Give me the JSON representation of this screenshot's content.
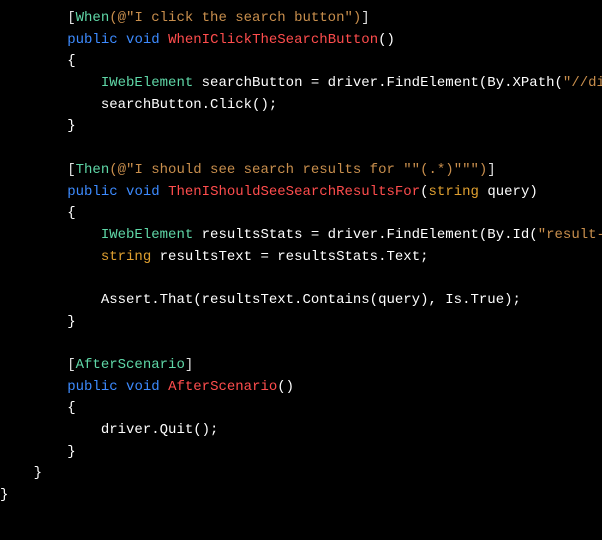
{
  "code": {
    "indent0": "",
    "indent1": "}",
    "indent2a": "}",
    "m1": {
      "attrOpen": "[",
      "attrName": "When",
      "attrArg": "(@\"I click the search button\")",
      "attrClose": "]",
      "kwPublic": "public",
      "kwVoid": "void",
      "name": "WhenIClickTheSearchButton",
      "parens": "()",
      "lbrace": "{",
      "line1_a": "IWebElement",
      "line1_b": " searchButton = driver.FindElement(By.XPath(",
      "line1_str": "\"//div[@c",
      "line2": "searchButton.Click();",
      "rbrace": "}"
    },
    "m2": {
      "attrOpen": "[",
      "attrName": "Then",
      "attrArg": "(@\"I should see search results for \"\"(.*)\"\"\")",
      "attrClose": "]",
      "kwPublic": "public",
      "kwVoid": "void",
      "name": "ThenIShouldSeeSearchResultsFor",
      "paramType": "string",
      "paramName": " query)",
      "lparen": "(",
      "lbrace": "{",
      "line1_a": "IWebElement",
      "line1_b": " resultsStats = driver.FindElement(By.Id(",
      "line1_str": "\"result-stat",
      "line2_a": "string",
      "line2_b": " resultsText = resultsStats.Text;",
      "line3": "Assert.That(resultsText.Contains(query), Is.True);",
      "rbrace": "}"
    },
    "m3": {
      "attrOpen": "[",
      "attrName": "AfterScenario",
      "attrClose": "]",
      "kwPublic": "public",
      "kwVoid": "void",
      "name": "AfterScenario",
      "parens": "()",
      "lbrace": "{",
      "line1": "driver.Quit();",
      "rbrace": "}"
    }
  }
}
